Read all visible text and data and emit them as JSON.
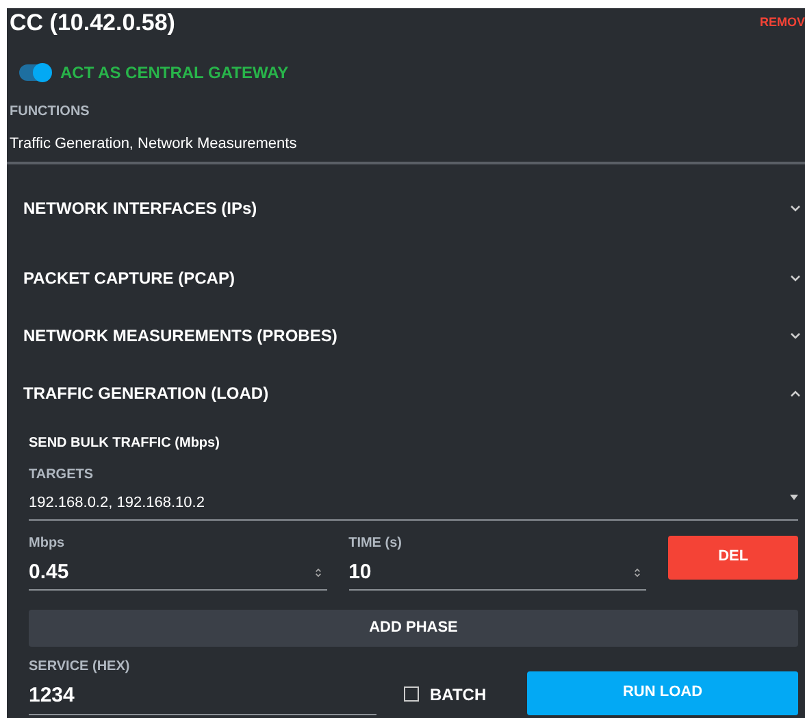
{
  "header": {
    "title": "CC (10.42.0.58)",
    "remove_link": "REMOV"
  },
  "gateway_toggle": {
    "label": "ACT AS CENTRAL GATEWAY",
    "on": true
  },
  "functions": {
    "label": "FUNCTIONS",
    "value": "Traffic Generation, Network Measurements"
  },
  "sections": [
    {
      "title": "NETWORK INTERFACES (IPs)",
      "expanded": false
    },
    {
      "title": "PACKET CAPTURE (PCAP)",
      "expanded": false
    },
    {
      "title": "NETWORK MEASUREMENTS (PROBES)",
      "expanded": false
    },
    {
      "title": "TRAFFIC GENERATION (LOAD)",
      "expanded": true
    }
  ],
  "load": {
    "heading": "SEND BULK TRAFFIC (Mbps)",
    "targets": {
      "label": "TARGETS",
      "value": "192.168.0.2, 192.168.10.2"
    },
    "phases": [
      {
        "mbps_label": "Mbps",
        "mbps": "0.45",
        "time_label": "TIME (s)",
        "time": "10",
        "delete_button": "DEL"
      }
    ],
    "add_phase_button": "ADD PHASE",
    "service": {
      "label": "SERVICE (HEX)",
      "value": "1234"
    },
    "batch": {
      "label": "BATCH",
      "checked": false
    },
    "run_button": "RUN LOAD"
  }
}
